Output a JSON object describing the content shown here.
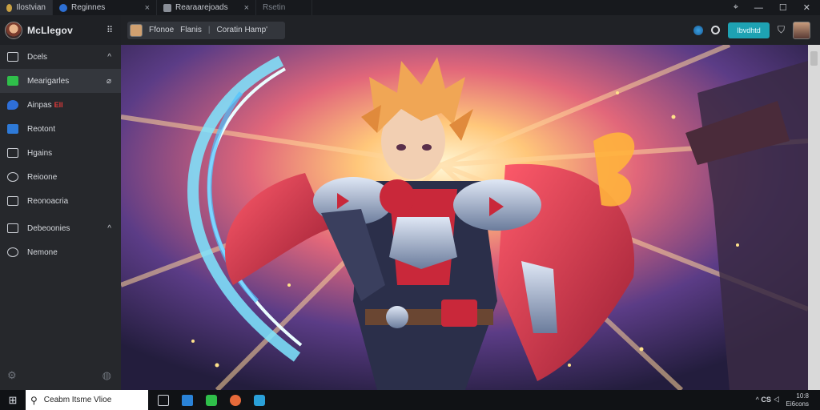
{
  "browser": {
    "tabs": [
      {
        "label": "Ilostvian",
        "close": ""
      },
      {
        "label": "Reginnes",
        "close": "×"
      },
      {
        "label": "Rearaarejoads",
        "close": "×"
      },
      {
        "label": "Rsetin",
        "close": ""
      }
    ],
    "window_controls": {
      "pin": "⌖",
      "minimize": "—",
      "maximize": "☐",
      "close": "✕"
    }
  },
  "app": {
    "title": "McLlegov",
    "grid_icon": "⠿",
    "breadcrumb": {
      "item1": "Ffonoe",
      "item2": "Flanis",
      "separator": "|",
      "item3": "Coratin Hamp'"
    },
    "cta_label": "Ibvdhtd",
    "accent": "#1ea2b3"
  },
  "sidebar": {
    "items": [
      {
        "label": "Dcels",
        "icon": "folder-icon",
        "trail": "^"
      },
      {
        "label": "Mearigarles",
        "icon": "green-tile-icon",
        "trail": "⌀"
      },
      {
        "label": "Ainpas",
        "icon": "blue-drop-icon",
        "badge": "Ell"
      },
      {
        "label": "Reotont",
        "icon": "house-icon"
      },
      {
        "label": "Hgains",
        "icon": "document-icon"
      },
      {
        "label": "Reioone",
        "icon": "compass-icon"
      },
      {
        "label": "Reonoacria",
        "icon": "envelope-icon"
      },
      {
        "label": "Debeoonies",
        "icon": "inbox-icon",
        "trail": "^"
      },
      {
        "label": "Nemone",
        "icon": "globe-icon"
      }
    ],
    "active_index": 1
  },
  "taskbar": {
    "search_placeholder": "Ceabm Itsme Vlioe",
    "tray_text": "^ 𝐂𝐒 ◁",
    "time": "10:8",
    "date": "Ei6cons"
  }
}
